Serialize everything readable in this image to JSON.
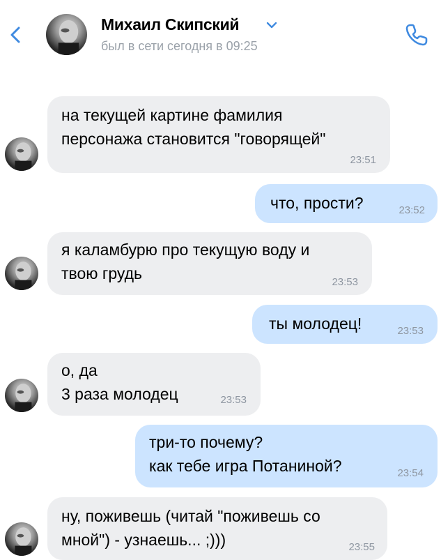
{
  "header": {
    "contact_name": "Михаил Скипский",
    "status": "был в сети сегодня в 09:25"
  },
  "colors": {
    "accent": "#3f8ae0",
    "incoming_bubble": "#edeef0",
    "outgoing_bubble": "#cce4ff",
    "time": "#8e96a1"
  },
  "icons": {
    "back": "chevron-left-icon",
    "dropdown": "chevron-down-icon",
    "call": "phone-icon"
  },
  "messages": [
    {
      "direction": "incoming",
      "lines": [
        "на текущей картине фамилия",
        "персонажа становится \"говорящей\""
      ],
      "time": "23:51"
    },
    {
      "direction": "outgoing",
      "lines": [
        "что, прости?"
      ],
      "time": "23:52"
    },
    {
      "direction": "incoming",
      "lines": [
        "я каламбурю про текущую воду и",
        "твою грудь"
      ],
      "time": "23:53"
    },
    {
      "direction": "outgoing",
      "lines": [
        "ты молодец!"
      ],
      "time": "23:53"
    },
    {
      "direction": "incoming",
      "lines": [
        "о, да",
        "3 раза молодец"
      ],
      "time": "23:53"
    },
    {
      "direction": "outgoing",
      "lines": [
        "три-то почему?",
        "как тебе игра Потаниной?"
      ],
      "time": "23:54"
    },
    {
      "direction": "incoming",
      "lines": [
        "ну, поживешь (читай \"поживешь со",
        "мной\") - узнаешь... ;)))"
      ],
      "time": "23:55"
    }
  ]
}
